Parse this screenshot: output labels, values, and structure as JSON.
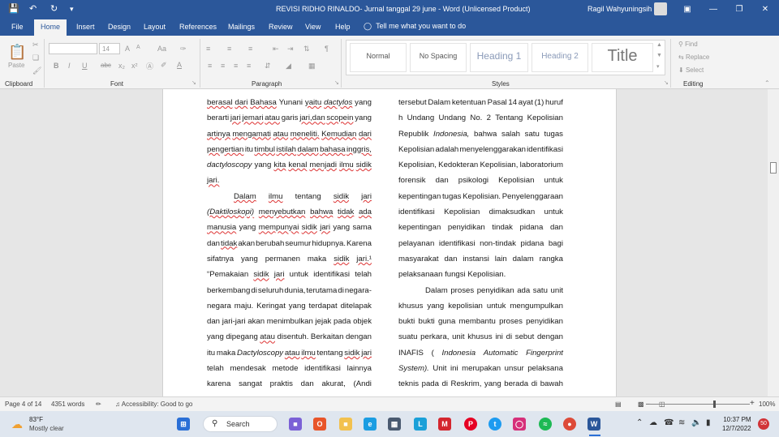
{
  "window": {
    "title": "REVISI RIDHO RINALDO- Jurnal tanggal 29 june  -  Word (Unlicensed Product)",
    "user": "Ragil Wahyuningsih",
    "save_icon": "save-icon",
    "undo_icon": "undo-icon",
    "redo_icon": "redo-icon"
  },
  "menu_tabs": [
    "File",
    "Home",
    "Insert",
    "Design",
    "Layout",
    "References",
    "Mailings",
    "Review",
    "View",
    "Help"
  ],
  "tell_me": "Tell me what you want to do",
  "ribbon": {
    "clipboard": {
      "paste": "Paste",
      "label": "Clipboard"
    },
    "font": {
      "size": "14",
      "label": "Font",
      "bold": "B",
      "italic": "I",
      "underline": "U",
      "strike": "abc",
      "sub": "x₂",
      "sup": "x²",
      "grow": "A",
      "shrink": "A",
      "case": "Aa"
    },
    "paragraph": {
      "label": "Paragraph"
    },
    "styles": {
      "label": "Styles",
      "items": [
        "Normal",
        "No Spacing",
        "Heading 1",
        "Heading 2",
        "Title"
      ]
    },
    "editing": {
      "find": "Find",
      "replace": "Replace",
      "select": "Select",
      "label": "Editing"
    }
  },
  "document": {
    "left_column": [
      "berasal dari Bahasa Yunani yaitu dactylos yang",
      "berarti jari jemari atau garis jari,dan scopein yang",
      "artinya mengamati atau meneliti. Kemudian dari",
      "pengertian itu timbul istilah dalam bahasa inggris,",
      "dactyloscopy yang kita kenal menjadi ilmu sidik",
      "jari.",
      "Dalam ilmu tentang sidik jari",
      "(Daktiloskopi) menyebutkan bahwa tidak ada",
      "manusia yang mempunyai sidik jari yang sama",
      "dan tidak akan berubah seumur hidupnya. Karena",
      "sifatnya yang permanen maka sidik jari.¹",
      "“Pemakaian sidik jari untuk identifikasi telah",
      "berkembang di seluruh dunia, terutama di negara-",
      "negara maju. Keringat yang terdapat ditelapak",
      "dan jari-jari akan menimbulkan jejak pada objek",
      "yang dipegang atau disentuh. Berkaitan dengan",
      "itu maka Dactyloscopy atau ilmu tentang sidik jari",
      "telah mendesak metode identifikasi lainnya",
      "karena sangat praktis dan akurat, (Andi"
    ],
    "right_column": [
      "tersebut Dalam ketentuan Pasal 14 ayat (1) huruf",
      "h Undang Undang No. 2 Tentang Kepolisian",
      "Republik Indonesia, bahwa salah satu tugas",
      "Kepolisian adalah menyelenggarakan identifikasi",
      "Kepolisian, Kedokteran Kepolisian, laboratorium",
      "forensik dan psikologi Kepolisian untuk",
      "kepentingan tugas Kepolisian. Penyelenggaraan",
      "identifikasi Kepolisian dimaksudkan untuk",
      "kepentingan penyidikan tindak pidana dan",
      "pelayanan identifikasi non-tindak pidana bagi",
      "masyarakat dan instansi lain dalam rangka",
      "pelaksanaan fungsi Kepolisian.",
      "Dalam proses penyidikan ada satu unit",
      "khusus yang kepolisian untuk mengumpulkan",
      "bukti bukti guna membantu proses penyidikan",
      "suatu perkara, unit khusus ini di sebut dengan",
      "INAFIS ( Indonesia Automatic Fingerprint",
      "System). Unit ini merupakan unsur pelaksana",
      "teknis pada di Reskrim, yang berada di bawah"
    ]
  },
  "status_bar": {
    "page": "Page 4 of 14",
    "words": "4351 words",
    "accessibility": "Accessibility: Good to go",
    "zoom": "100%",
    "zoom_level": 1.0
  },
  "taskbar": {
    "temperature": "83°F",
    "weather": "Mostly clear",
    "search": "Search",
    "time": "10:37 PM",
    "date": "12/7/2022",
    "notifications": "50"
  }
}
